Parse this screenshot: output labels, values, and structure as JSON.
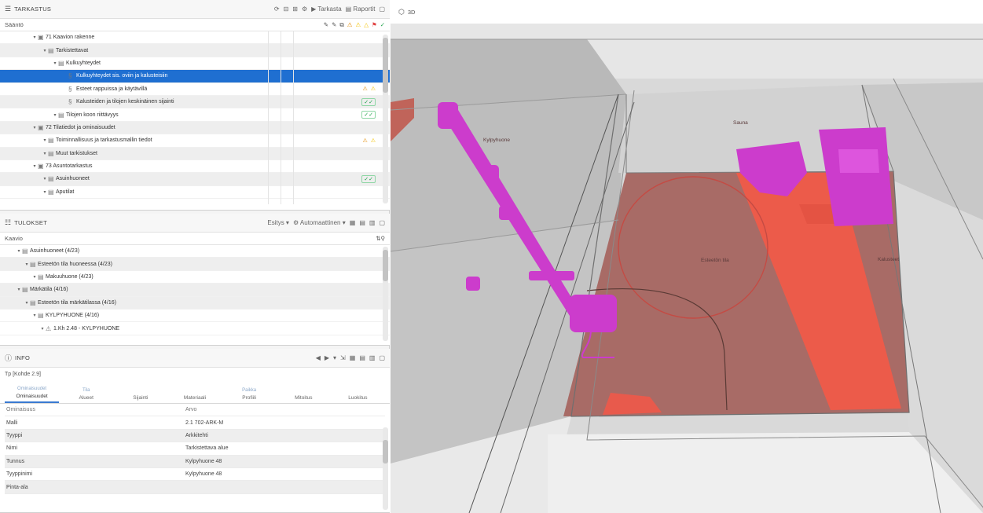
{
  "tree_panel": {
    "title": "TARKASTUS",
    "toolbar": [
      "Tarkasta",
      "Raportit"
    ],
    "column_header": "Sääntö",
    "items": [
      {
        "label": "71 Kaavion rakenne",
        "level": 0,
        "icon": "ruleset-icon",
        "status": ""
      },
      {
        "label": "Tarkistettavat",
        "level": 1,
        "icon": "folder-icon",
        "status": ""
      },
      {
        "label": "Kulkuyhteydet",
        "level": 2,
        "icon": "folder-icon",
        "status": ""
      },
      {
        "label": "Kulkuyhteydet sis. oviin ja kalusteisiin",
        "level": 3,
        "icon": "rule-icon",
        "status": "",
        "selected": true
      },
      {
        "label": "Esteet rappuissa ja käytävillä",
        "level": 3,
        "icon": "rule-icon",
        "status": "warn"
      },
      {
        "label": "Kalusteiden ja tilojen keskinäinen sijainti",
        "level": 3,
        "icon": "rule-icon",
        "status": "ok"
      },
      {
        "label": "Tilojen koon riittävyys",
        "level": 2,
        "icon": "folder-icon",
        "status": "ok"
      },
      {
        "label": "72 Tilatiedot ja ominaisuudet",
        "level": 0,
        "icon": "ruleset-icon",
        "status": ""
      },
      {
        "label": "Toiminnallisuus ja tarkastusmallin tiedot",
        "level": 1,
        "icon": "folder-icon",
        "status": "warn"
      },
      {
        "label": "Muut tarkistukset",
        "level": 1,
        "icon": "folder-icon",
        "status": ""
      },
      {
        "label": "73 Asuntotarkastus",
        "level": 0,
        "icon": "ruleset-icon",
        "status": ""
      },
      {
        "label": "Asuinhuoneet",
        "level": 1,
        "icon": "folder-icon",
        "status": "ok"
      },
      {
        "label": "Aputilat",
        "level": 1,
        "icon": "folder-icon",
        "status": ""
      }
    ]
  },
  "results_panel": {
    "title": "TULOKSET",
    "toolbar": [
      "Esitys",
      "Automaattinen"
    ],
    "column_header": "Kaavio",
    "items": [
      {
        "label": "Asuinhuoneet (4/23)",
        "level": 0
      },
      {
        "label": "Esteetön tila huoneessa (4/23)",
        "level": 1
      },
      {
        "label": "Makuuhuone (4/23)",
        "level": 2
      },
      {
        "label": "Märkätila (4/16)",
        "level": 0
      },
      {
        "label": "Esteetön tila märkätilassa (4/16)",
        "level": 1
      },
      {
        "label": "KYLPYHUONE (4/16)",
        "level": 2
      },
      {
        "label": "1.Kh 2.48 - KYLPYHUONE",
        "level": 3,
        "warning": true
      }
    ]
  },
  "info_panel": {
    "title": "INFO",
    "subtitle": "Tp [Kohde 2.9]",
    "tabs": [
      {
        "group": "Ominaisuudet",
        "label": "Ominaisuudet",
        "active": true
      },
      {
        "group": "Tila",
        "label": "Alueet"
      },
      {
        "group": "",
        "label": "Sijainti"
      },
      {
        "group": "",
        "label": "Materiaali"
      },
      {
        "group": "Paikka",
        "label": "Profiili"
      },
      {
        "group": "",
        "label": "Mitoitus"
      },
      {
        "group": "",
        "label": "Luokitus"
      }
    ],
    "header": {
      "key": "Ominaisuus",
      "value": "Arvo"
    },
    "properties": [
      {
        "key": "Malli",
        "value": "2.1 702-ARK-M"
      },
      {
        "key": "Tyyppi",
        "value": "Arkkitehti"
      },
      {
        "key": "Nimi",
        "value": "Tarkistettava alue"
      },
      {
        "key": "Tunnus",
        "value": "Kylpyhuone 48"
      },
      {
        "key": "Tyyppinimi",
        "value": "Kylpyhuone 48"
      },
      {
        "key": "Pinta-ala",
        "value": ""
      }
    ]
  },
  "viewer": {
    "title": "3D",
    "labels": [
      "Kylpyhuone",
      "Sauna",
      "Esteetön tila",
      "Kalusteet"
    ],
    "colors": {
      "floor": "#a86b66",
      "highlight": "#ec5b4a",
      "fixtures": "#cc3ccc",
      "walls": "#cfcfcf"
    }
  }
}
